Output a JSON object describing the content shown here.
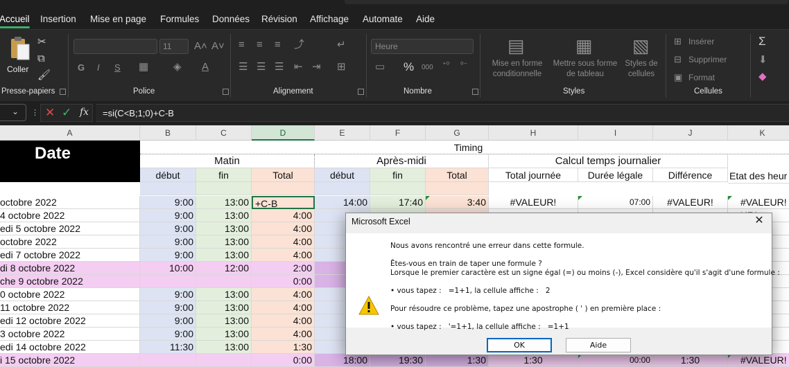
{
  "menu": {
    "tabs": [
      "Accueil",
      "Insertion",
      "Mise en page",
      "Formules",
      "Données",
      "Révision",
      "Affichage",
      "Automate",
      "Aide"
    ],
    "active": "Accueil"
  },
  "ribbon": {
    "clipboard": {
      "paste_label": "Coller",
      "group_label": "Presse-papiers"
    },
    "font": {
      "size_value": "11",
      "bold": "G",
      "italic": "I",
      "underline": "S",
      "grow": "A˄",
      "shrink": "A˅",
      "color_letter": "A",
      "group_label": "Police"
    },
    "alignment": {
      "group_label": "Alignement"
    },
    "number": {
      "format_value": "Heure",
      "percent": "%",
      "thousands": "000",
      "group_label": "Nombre"
    },
    "styles": {
      "conditional": "Mise en forme conditionnelle",
      "table": "Mettre sous forme de tableau",
      "cell_styles": "Styles de cellules",
      "group_label": "Styles"
    },
    "cells": {
      "insert": "Insérer",
      "delete": "Supprimer",
      "format": "Format",
      "group_label": "Cellules"
    },
    "editing": {
      "sum": "Σ"
    }
  },
  "formula_bar": {
    "fx": "fx",
    "formula": "=si(C<B;1;0)+C-B"
  },
  "sheet": {
    "columns": [
      "A",
      "B",
      "C",
      "D",
      "E",
      "F",
      "G",
      "H",
      "I",
      "J",
      "K"
    ],
    "selected_column": "D",
    "header": {
      "date": "Date",
      "timing": "Timing",
      "matin": "Matin",
      "apres_midi": "Après-midi",
      "calcul": "Calcul temps journalier",
      "debut": "début",
      "fin": "fin",
      "total": "Total",
      "total_journee": "Total journée",
      "duree_legale": "Durée légale",
      "difference": "Différence",
      "etat": "Etat des heur"
    },
    "rows": [
      {
        "a": " octobre 2022",
        "b": "9:00",
        "c": "13:00",
        "d": "+C-B",
        "e": "14:00",
        "f": "17:40",
        "g": "3:40",
        "h": "#VALEUR!",
        "i": "07:00",
        "j": "#VALEUR!",
        "k": "#VALEUR!",
        "fill": "white"
      },
      {
        "a": "4 octobre 2022",
        "b": "9:00",
        "c": "13:00",
        "d": "4:00",
        "k": "UR!",
        "fill": "white"
      },
      {
        "a": "edi 5 octobre 2022",
        "b": "9:00",
        "c": "13:00",
        "d": "4:00",
        "k": "UR!",
        "fill": "white"
      },
      {
        "a": " octobre 2022",
        "b": "9:00",
        "c": "13:00",
        "d": "4:00",
        "k": "UR!",
        "fill": "white"
      },
      {
        "a": "edi 7 octobre 2022",
        "b": "9:00",
        "c": "13:00",
        "d": "4:00",
        "k": "UR!",
        "fill": "white"
      },
      {
        "a": "di 8 octobre 2022",
        "b": "10:00",
        "c": "12:00",
        "d": "2:00",
        "k": "UR!",
        "fill": "pink"
      },
      {
        "a": "che 9 octobre 2022",
        "b": "",
        "c": "",
        "d": "0:00",
        "k": "UR!",
        "fill": "pink"
      },
      {
        "a": "0 octobre 2022",
        "b": "9:00",
        "c": "13:00",
        "d": "4:00",
        "k": "UR!",
        "fill": "white"
      },
      {
        "a": "11 octobre 2022",
        "b": "9:00",
        "c": "13:00",
        "d": "4:00",
        "k": "UR!",
        "fill": "white"
      },
      {
        "a": "edi 12 octobre 2022",
        "b": "9:00",
        "c": "13:00",
        "d": "4:00",
        "k": "UR!",
        "fill": "white"
      },
      {
        "a": "3 octobre 2022",
        "b": "9:00",
        "c": "13:00",
        "d": "4:00",
        "k": "UR!",
        "fill": "white"
      },
      {
        "a": "edi 14 octobre 2022",
        "b": "11:30",
        "c": "13:00",
        "d": "1:30",
        "k": "UR!",
        "fill": "white"
      },
      {
        "a": "i 15 octobre 2022",
        "b": "",
        "c": "",
        "d": "0:00",
        "e": "18:00",
        "f": "19:30",
        "g": "1:30",
        "h": "1:30",
        "i": "00:00",
        "j": "1:30",
        "k": "#VALEUR!",
        "fill": "pink"
      }
    ]
  },
  "dialog": {
    "title": "Microsoft Excel",
    "line1": "Nous avons rencontré une erreur dans cette formule.",
    "line2": "Êtes-vous en train de taper une formule ?",
    "line3": "Lorsque le premier caractère est un signe égal (=) ou moins (-), Excel considère qu'il s'agit d'une formule :",
    "line4": "• vous tapez :   =1+1, la cellule affiche :   2",
    "line5": "Pour résoudre ce problème, tapez une apostrophe ( ' ) en première place :",
    "line6": "• vous tapez :   '=1+1, la cellule affiche :   =1+1",
    "ok": "OK",
    "help": "Aide"
  }
}
